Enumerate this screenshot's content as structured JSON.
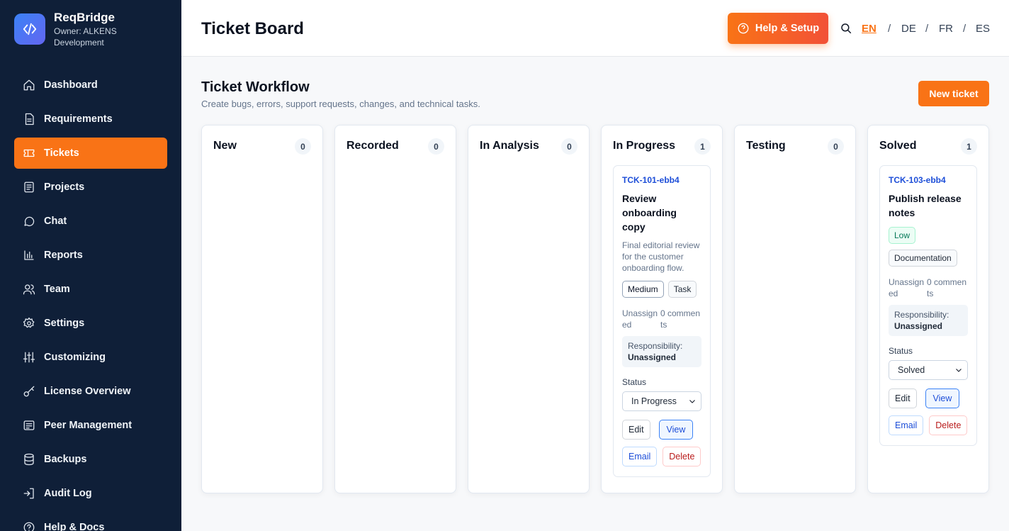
{
  "brand": {
    "name": "ReqBridge",
    "owner": "Owner: ALKENS Development"
  },
  "sidebar": {
    "items": [
      {
        "label": "Dashboard",
        "icon": "home-icon"
      },
      {
        "label": "Requirements",
        "icon": "document-icon"
      },
      {
        "label": "Tickets",
        "icon": "ticket-icon",
        "active": true
      },
      {
        "label": "Projects",
        "icon": "projects-icon"
      },
      {
        "label": "Chat",
        "icon": "chat-icon"
      },
      {
        "label": "Reports",
        "icon": "bar-chart-icon"
      },
      {
        "label": "Team",
        "icon": "team-icon"
      },
      {
        "label": "Settings",
        "icon": "gear-icon"
      },
      {
        "label": "Customizing",
        "icon": "sliders-icon"
      },
      {
        "label": "License Overview",
        "icon": "key-icon"
      },
      {
        "label": "Peer Management",
        "icon": "list-icon"
      },
      {
        "label": "Backups",
        "icon": "database-icon"
      },
      {
        "label": "Audit Log",
        "icon": "login-icon"
      },
      {
        "label": "Help & Docs",
        "icon": "help-icon"
      }
    ]
  },
  "header": {
    "title": "Ticket Board",
    "help_label": "Help & Setup",
    "languages": [
      "EN",
      "DE",
      "FR",
      "ES"
    ],
    "active_language": "EN"
  },
  "main": {
    "title": "Ticket Workflow",
    "subtitle": "Create bugs, errors, support requests, changes, and technical tasks.",
    "new_ticket_label": "New ticket"
  },
  "columns": [
    {
      "title": "New",
      "count": "0"
    },
    {
      "title": "Recorded",
      "count": "0"
    },
    {
      "title": "In Analysis",
      "count": "0"
    },
    {
      "title": "In Progress",
      "count": "1"
    },
    {
      "title": "Testing",
      "count": "0"
    },
    {
      "title": "Solved",
      "count": "1"
    }
  ],
  "cards": {
    "in_progress": {
      "id": "TCK-101-ebb4",
      "title": "Review onboarding copy",
      "description": "Final editorial review for the customer onboarding flow.",
      "priority": "Medium",
      "type": "Task",
      "assignee": "Unassigned",
      "comments": "0 comments",
      "responsibility_label": "Responsibility:",
      "responsibility_value": "Unassigned",
      "status_label": "Status",
      "status_value": "In Progress",
      "edit_label": "Edit",
      "view_label": "View",
      "email_label": "Email",
      "delete_label": "Delete"
    },
    "solved": {
      "id": "TCK-103-ebb4",
      "title": "Publish release notes",
      "priority": "Low",
      "type": "Documentation",
      "assignee": "Unassigned",
      "comments": "0 comments",
      "responsibility_label": "Responsibility:",
      "responsibility_value": "Unassigned",
      "status_label": "Status",
      "status_value": "Solved",
      "edit_label": "Edit",
      "view_label": "View",
      "email_label": "Email",
      "delete_label": "Delete"
    }
  },
  "colors": {
    "accent": "#f97316",
    "sidebar": "#0f1f38",
    "link": "#1d4ed8"
  }
}
